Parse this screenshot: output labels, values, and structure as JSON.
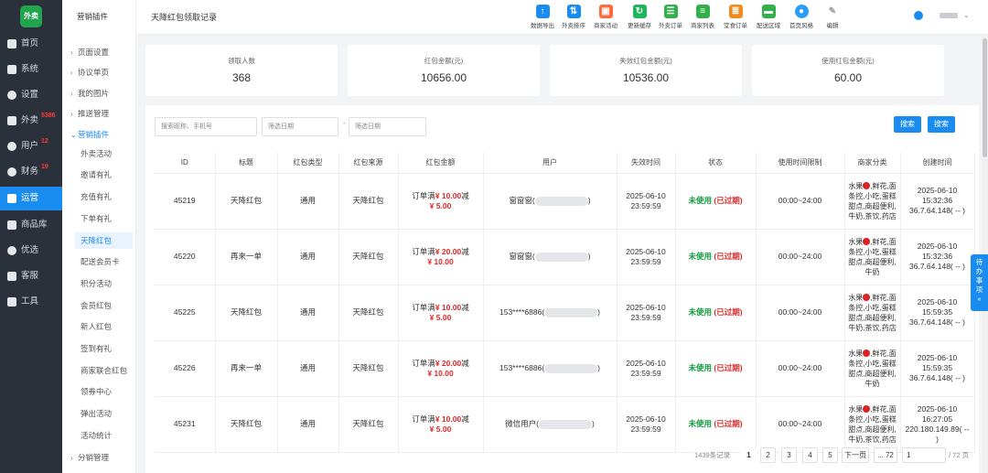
{
  "app": {
    "logo": "外卖"
  },
  "sidebar": {
    "items": [
      {
        "label": "首页",
        "badge": "",
        "icon": "monitor-icon"
      },
      {
        "label": "系统",
        "badge": "",
        "icon": "network-icon"
      },
      {
        "label": "设置",
        "badge": "",
        "icon": "gear-icon"
      },
      {
        "label": "外卖",
        "badge": "5386",
        "icon": "cart-icon"
      },
      {
        "label": "用户",
        "badge": "12",
        "icon": "user-icon"
      },
      {
        "label": "财务",
        "badge": "19",
        "icon": "money-icon"
      },
      {
        "label": "运营",
        "badge": "",
        "icon": "chart-icon"
      },
      {
        "label": "商品库",
        "badge": "",
        "icon": "grid-icon"
      },
      {
        "label": "优选",
        "badge": "",
        "icon": "star-icon"
      },
      {
        "label": "客服",
        "badge": "",
        "icon": "headset-icon"
      },
      {
        "label": "工具",
        "badge": "",
        "icon": "toolbox-icon"
      }
    ]
  },
  "subnav": {
    "title": "营销插件",
    "groups": [
      "页面设置",
      "协议单页",
      "我的图片",
      "推送管理"
    ],
    "open_group": "营销插件",
    "items": [
      "外卖活动",
      "邀请有礼",
      "充值有礼",
      "下单有礼",
      "天降红包",
      "配送会员卡",
      "积分活动",
      "会员红包",
      "新人红包",
      "签到有礼",
      "商家联合红包",
      "领券中心",
      "弹出活动",
      "活动统计"
    ],
    "footer_group": "分销管理"
  },
  "topbar": {
    "title": "天降红包领取记录",
    "tools": [
      {
        "label": "数据导出",
        "icon": "upload-icon",
        "color": "#1a8cf0"
      },
      {
        "label": "外卖排序",
        "icon": "sort-icon",
        "color": "#1a8cf0"
      },
      {
        "label": "商家活动",
        "icon": "gift-icon",
        "color": "#ff6a3d"
      },
      {
        "label": "更新缓存",
        "icon": "refresh-icon",
        "color": "#1fb55a"
      },
      {
        "label": "外卖订单",
        "icon": "clipboard-icon",
        "color": "#32b04a"
      },
      {
        "label": "商家列表",
        "icon": "list-icon",
        "color": "#32b04a"
      },
      {
        "label": "堂食订单",
        "icon": "receipt-icon",
        "color": "#f28b1c"
      },
      {
        "label": "配送区域",
        "icon": "truck-icon",
        "color": "#32b04a"
      },
      {
        "label": "首页风格",
        "icon": "palette-icon",
        "color": "#2a9df4"
      },
      {
        "label": "编辑",
        "icon": "edit-icon",
        "color": "#9aa0a6"
      }
    ]
  },
  "stats": [
    {
      "label": "领取人数",
      "value": "368"
    },
    {
      "label": "红包金额(元)",
      "value": "10656.00"
    },
    {
      "label": "失效红包金额(元)",
      "value": "10536.00"
    },
    {
      "label": "使用红包金额(元)",
      "value": "60.00"
    }
  ],
  "filters": {
    "keyword_placeholder": "搜索昵称、手机号",
    "start_placeholder": "筛选日期",
    "sep": "-",
    "end_placeholder": "筛选日期",
    "search_label": "搜索",
    "export_label": "搜索"
  },
  "table": {
    "headers": [
      "ID",
      "标题",
      "红包类型",
      "红包来源",
      "红包金额",
      "用户",
      "失效时间",
      "状态",
      "使用时间限制",
      "商家分类",
      "创建时间"
    ],
    "rows": [
      {
        "id": "45219",
        "title": "天降红包",
        "type": "通用",
        "source": "天降红包",
        "amt_pre": "订单满",
        "amt_min": "¥ 10.00",
        "amt_mid": "减",
        "amt_off": "¥ 5.00",
        "user": "窗窗窗(",
        "expire_d": "2025-06-10",
        "expire_t": "23:59:59",
        "status": "未使用",
        "status2": "(已过期)",
        "limit": "00:00~24:00",
        "cat1": "水果",
        "cat2": ",鲜花,面条控,小吃,蛋糕甜点,商超便利,牛奶,茶饮,药店",
        "create_d": "2025-06-10",
        "create_t": "15:32:36",
        "ip": "36.7.64.148( -- )"
      },
      {
        "id": "45220",
        "title": "再来一单",
        "type": "通用",
        "source": "天降红包",
        "amt_pre": "订单满",
        "amt_min": "¥ 20.00",
        "amt_mid": "减",
        "amt_off": "¥ 10.00",
        "user": "窗窗窗(",
        "expire_d": "2025-06-10",
        "expire_t": "23:59:59",
        "status": "未使用",
        "status2": "(已过期)",
        "limit": "00:00~24:00",
        "cat1": "水果",
        "cat2": ",鲜花,面条控,小吃,蛋糕甜点,商超便利,牛奶",
        "create_d": "2025-06-10",
        "create_t": "15:32:36",
        "ip": "36.7.64.148( -- )"
      },
      {
        "id": "45225",
        "title": "天降红包",
        "type": "通用",
        "source": "天降红包",
        "amt_pre": "订单满",
        "amt_min": "¥ 10.00",
        "amt_mid": "减",
        "amt_off": "¥ 5.00",
        "user": "153****6886(",
        "expire_d": "2025-06-10",
        "expire_t": "23:59:59",
        "status": "未使用",
        "status2": "(已过期)",
        "limit": "00:00~24:00",
        "cat1": "水果",
        "cat2": ",鲜花,面条控,小吃,蛋糕甜点,商超便利,牛奶,茶饮,药店",
        "create_d": "2025-06-10",
        "create_t": "15:59:35",
        "ip": "36.7.64.148( -- )"
      },
      {
        "id": "45226",
        "title": "再来一单",
        "type": "通用",
        "source": "天降红包",
        "amt_pre": "订单满",
        "amt_min": "¥ 20.00",
        "amt_mid": "减",
        "amt_off": "¥ 10.00",
        "user": "153****6886(",
        "expire_d": "2025-06-10",
        "expire_t": "23:59:59",
        "status": "未使用",
        "status2": "(已过期)",
        "limit": "00:00~24:00",
        "cat1": "水果",
        "cat2": ",鲜花,面条控,小吃,蛋糕甜点,商超便利,牛奶",
        "create_d": "2025-06-10",
        "create_t": "15:59:35",
        "ip": "36.7.64.148( -- )"
      },
      {
        "id": "45231",
        "title": "天降红包",
        "type": "通用",
        "source": "天降红包",
        "amt_pre": "订单满",
        "amt_min": "¥ 10.00",
        "amt_mid": "减",
        "amt_off": "¥ 5.00",
        "user": "微信用户(",
        "expire_d": "2025-06-10",
        "expire_t": "23:59:59",
        "status": "未使用",
        "status2": "(已过期)",
        "limit": "00:00~24:00",
        "cat1": "水果",
        "cat2": ",鲜花,面条控,小吃,蛋糕甜点,商超便利,牛奶,茶饮,药店",
        "create_d": "2025-06-10",
        "create_t": "16:27:05",
        "ip": "220.180.149.89( -- )"
      }
    ]
  },
  "pagination": {
    "total": "1439条记录",
    "pages": [
      "1",
      "2",
      "3",
      "4",
      "5"
    ],
    "next": "下一页",
    "last": "... 72",
    "goto_value": "1",
    "total_pages": "/ 72 页"
  },
  "float_tab": {
    "label": "待办事项",
    "icon": "chevron-left-icon"
  }
}
